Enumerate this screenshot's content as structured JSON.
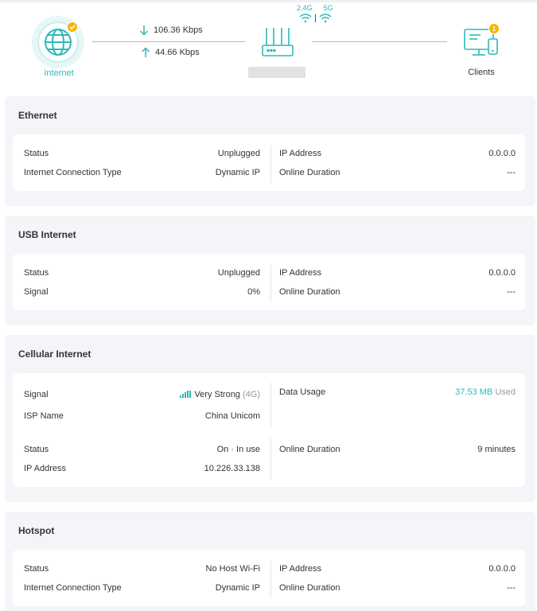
{
  "topology": {
    "internet_label": "Internet",
    "download_rate": "106.36 Kbps",
    "upload_rate": "44.66 Kbps",
    "band_24": "2.4G",
    "band_5": "5G",
    "clients_label": "Clients",
    "clients_badge": "1",
    "colors": {
      "accent": "#2fb8b8",
      "badge": "#f7b500"
    }
  },
  "ethernet": {
    "title": "Ethernet",
    "left": [
      {
        "label": "Status",
        "value": "Unplugged"
      },
      {
        "label": "Internet Connection Type",
        "value": "Dynamic IP"
      }
    ],
    "right": [
      {
        "label": "IP Address",
        "value": "0.0.0.0"
      },
      {
        "label": "Online Duration",
        "value": "---"
      }
    ]
  },
  "usb": {
    "title": "USB Internet",
    "left": [
      {
        "label": "Status",
        "value": "Unplugged"
      },
      {
        "label": "Signal",
        "value": "0%"
      }
    ],
    "right": [
      {
        "label": "IP Address",
        "value": "0.0.0.0"
      },
      {
        "label": "Online Duration",
        "value": "---"
      }
    ]
  },
  "cellular": {
    "title": "Cellular Internet",
    "signal_label": "Signal",
    "signal_value": "Very Strong",
    "signal_network": "(4G)",
    "isp_label": "ISP Name",
    "isp_value": "China Unicom",
    "data_usage_label": "Data Usage",
    "data_usage_value": "37.53 MB",
    "data_usage_suffix": "Used",
    "status_label": "Status",
    "status_value": "On · In use",
    "ip_label": "IP Address",
    "ip_value": "10.226.33.138",
    "duration_label": "Online Duration",
    "duration_value": "9 minutes"
  },
  "hotspot": {
    "title": "Hotspot",
    "left": [
      {
        "label": "Status",
        "value": "No Host Wi-Fi"
      },
      {
        "label": "Internet Connection Type",
        "value": "Dynamic IP"
      }
    ],
    "right": [
      {
        "label": "IP Address",
        "value": "0.0.0.0"
      },
      {
        "label": "Online Duration",
        "value": "---"
      }
    ]
  }
}
